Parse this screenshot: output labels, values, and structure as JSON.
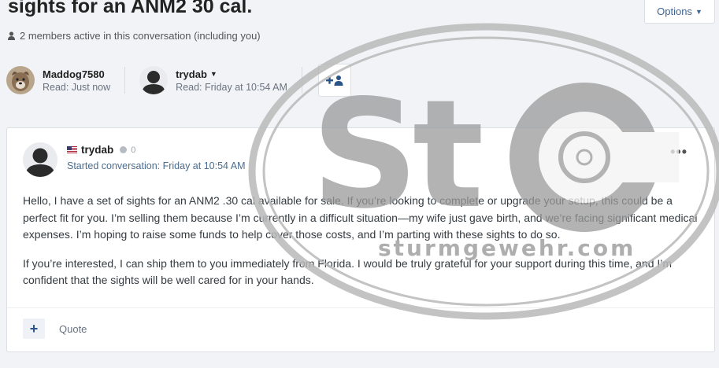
{
  "topic": {
    "title": "sights for an ANM2 30 cal.",
    "options_label": "Options",
    "active_members": "2 members active in this conversation (including you)"
  },
  "participants": [
    {
      "name": "Maddog7580",
      "read": "Read: Just now"
    },
    {
      "name": "trydab",
      "read": "Read: Friday at 10:54 AM"
    }
  ],
  "post": {
    "author": "trydab",
    "reputation": "0",
    "started": "Started conversation: Friday at 10:54 AM",
    "paragraphs": [
      "Hello, I have a set of sights for an ANM2 .30 cal available for sale. If you’re looking to complete or upgrade your setup, this could be a perfect fit for you. I’m selling them because I’m currently in a difficult situation—my wife just gave birth, and we’re facing significant medical expenses. I’m hoping to raise some funds to help cover those costs, and I’m parting with these sights to do so.",
      "If you’re interested, I can ship them to you immediately from Florida. I would be truly grateful for your support during this time, and I’m confident that the sights will be well cared for in your hands."
    ],
    "more_label": "•••",
    "quote_label": "Quote",
    "plus_label": "+"
  },
  "watermark": {
    "logo": "St",
    "url": "sturmgewehr.com"
  }
}
